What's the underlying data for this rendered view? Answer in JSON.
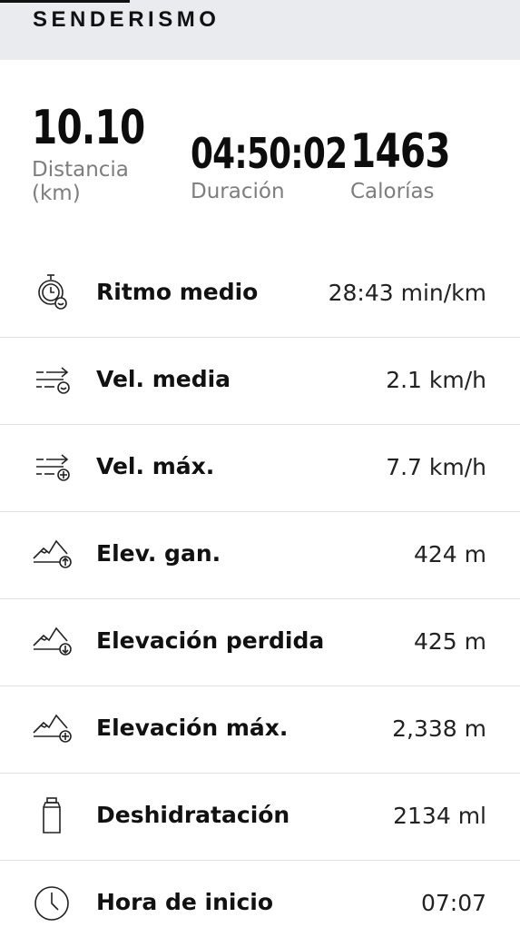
{
  "header": {
    "title": "SENDERISMO"
  },
  "summary": {
    "distance": {
      "value": "10.10",
      "label": "Distancia (km)"
    },
    "duration": {
      "value": "04:50:02",
      "label": "Duración"
    },
    "calories": {
      "value": "1463",
      "label": "Calorías"
    }
  },
  "metrics": [
    {
      "label": "Ritmo medio",
      "value": "28:43 min/km",
      "icon": "stopwatch-icon"
    },
    {
      "label": "Vel. media",
      "value": "2.1 km/h",
      "icon": "speed-average-icon"
    },
    {
      "label": "Vel. máx.",
      "value": "7.7 km/h",
      "icon": "speed-max-icon"
    },
    {
      "label": "Elev. gan.",
      "value": "424 m",
      "icon": "elevation-gain-icon"
    },
    {
      "label": "Elevación perdida",
      "value": "425 m",
      "icon": "elevation-loss-icon"
    },
    {
      "label": "Elevación máx.",
      "value": "2,338 m",
      "icon": "elevation-max-icon"
    },
    {
      "label": "Deshidratación",
      "value": "2134 ml",
      "icon": "water-bottle-icon"
    },
    {
      "label": "Hora de inicio",
      "value": "07:07",
      "icon": "clock-icon"
    }
  ]
}
